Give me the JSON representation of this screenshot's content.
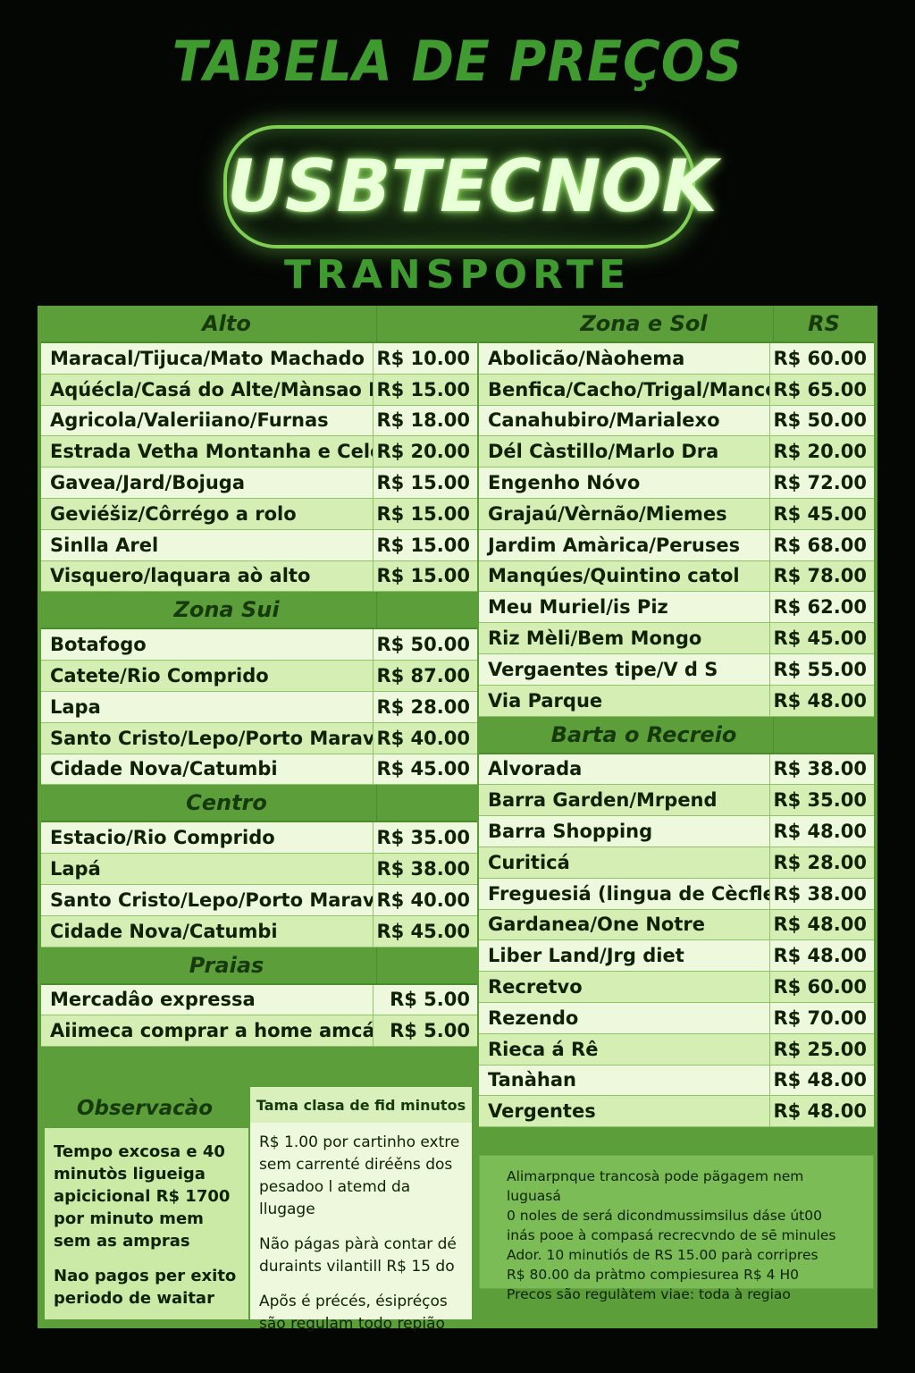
{
  "header": {
    "title": "TABELA DE PREÇOS",
    "logo": "USBTECNOK",
    "subtitle": "TRANSPORTE"
  },
  "left_sections": [
    {
      "title": "Alto",
      "rows": [
        {
          "name": "Maracal/Tijuca/Mato Machado",
          "price": "R$ 10.00"
        },
        {
          "name": "Aqúécla/Casá do Alte/Mànsao Rosá",
          "price": "R$ 15.00"
        },
        {
          "name": "Agricola/Valeriiano/Furnas",
          "price": "R$ 18.00"
        },
        {
          "name": "Estrada Vetha Montanha e Celes",
          "price": "R$ 20.00"
        },
        {
          "name": "Gavea/Jard/Bojuga",
          "price": "R$ 15.00"
        },
        {
          "name": "Geviéšiz/Côrrégo a rolo",
          "price": "R$ 15.00"
        },
        {
          "name": "Sinlla Arel",
          "price": "R$ 15.00"
        },
        {
          "name": "Visquero/laquara aò alto",
          "price": "R$ 15.00"
        }
      ]
    },
    {
      "title": "Zona Sui",
      "rows": [
        {
          "name": "Botafogo",
          "price": "R$ 50.00"
        },
        {
          "name": "Catete/Rio Comprido",
          "price": "R$ 87.00"
        },
        {
          "name": "Lapa",
          "price": "R$ 28.00"
        },
        {
          "name": "Santo Cristo/Lepo/Porto Maravilha",
          "price": "R$ 40.00"
        },
        {
          "name": "Cidade Nova/Catumbi",
          "price": "R$ 45.00"
        }
      ]
    },
    {
      "title": "Centro",
      "rows": [
        {
          "name": "Estacio/Rio Comprido",
          "price": "R$ 35.00"
        },
        {
          "name": "Lapá",
          "price": "R$ 38.00"
        },
        {
          "name": "Santo Cristo/Lepo/Porto Maravilha",
          "price": "R$ 40.00"
        },
        {
          "name": "Cidade Nova/Catumbi",
          "price": "R$ 45.00"
        }
      ]
    },
    {
      "title": "Praias",
      "rows": [
        {
          "name": "Mercadâo expressa",
          "price": "R$ 5.00"
        },
        {
          "name": "Aiimeca comprar a home amcása",
          "price": "R$ 5.00"
        }
      ]
    }
  ],
  "right_sections": [
    {
      "title": "Zona e Sol",
      "price_header": "RS",
      "rows": [
        {
          "name": "Abolicão/Nàohema",
          "price": "R$ 60.00"
        },
        {
          "name": "Benfica/Cacho/Trigal/Mances",
          "price": "R$ 65.00"
        },
        {
          "name": "Canahubiro/Marialexo",
          "price": "R$ 50.00"
        },
        {
          "name": "Dél Càstillo/Marlo Dra",
          "price": "R$ 20.00"
        },
        {
          "name": "Engenho Nóvo",
          "price": "R$ 72.00"
        },
        {
          "name": "Grajaú/Vèrnão/Miemes",
          "price": "R$ 45.00"
        },
        {
          "name": "Jardim Amàrica/Peruses",
          "price": "R$ 68.00"
        },
        {
          "name": "Manqúes/Quintino catol",
          "price": "R$ 78.00"
        },
        {
          "name": "Meu Muriel/is Piz",
          "price": "R$ 62.00"
        },
        {
          "name": "Riz Mèli/Bem Mongo",
          "price": "R$ 45.00"
        },
        {
          "name": "Vergaentes tipe/V d S",
          "price": "R$ 55.00"
        },
        {
          "name": "Via Parque",
          "price": "R$ 48.00"
        }
      ]
    },
    {
      "title": "Barta o Recreio",
      "price_header": "",
      "rows": [
        {
          "name": "Alvorada",
          "price": "R$ 38.00"
        },
        {
          "name": "Barra Garden/Mrpend",
          "price": "R$ 35.00"
        },
        {
          "name": "Barra Shopping",
          "price": "R$ 48.00"
        },
        {
          "name": "Curiticá",
          "price": "R$ 28.00"
        },
        {
          "name": "Freguesiá (lingua de Cècfle)",
          "price": "R$ 38.00"
        },
        {
          "name": "Gardanea/One Notre",
          "price": "R$ 48.00"
        },
        {
          "name": "Liber Land/Jrg diet",
          "price": "R$ 48.00"
        },
        {
          "name": "Recretvo",
          "price": "R$ 60.00"
        },
        {
          "name": "Rezendo",
          "price": "R$ 70.00"
        },
        {
          "name": "Rieca á Rê",
          "price": "R$ 25.00"
        },
        {
          "name": "Tanàhan",
          "price": "R$ 48.00"
        },
        {
          "name": "Vergentes",
          "price": "R$ 48.00"
        }
      ]
    }
  ],
  "observacao": {
    "title": "Observacào",
    "left_paragraphs": [
      "Tempo excosa e 40 minutòs ligueiga apicicional  R$ 1700 por minuto mem sem as ampras",
      "Nao pagos per exito periodo de waitar"
    ],
    "right_title": "Tama clasa de fid minutos",
    "right_paragraphs": [
      "R$ 1.00 por cartinho extre sem carrenté diréěns dos pesadoo l atemd da llugage",
      "Não págas pàrà contar dé duraints vilantill R$ 15 do",
      "Apõs é précés, ésipréços são regulam todo repião"
    ]
  },
  "note": [
    "Alimarpnque trancosà pode pägagem nem luguasá",
    "0 noles de será dicondmussimsilus dáse út00",
    "inás pooe à compasá recrecvndo de sē minules",
    "Ador. 10 minutiós de RS 15.00 parà corripres",
    "R$ 80.00 da pràtmo compiesurea R$ 4 H0",
    "Precos são regulàtem viae: toda à regiao"
  ]
}
